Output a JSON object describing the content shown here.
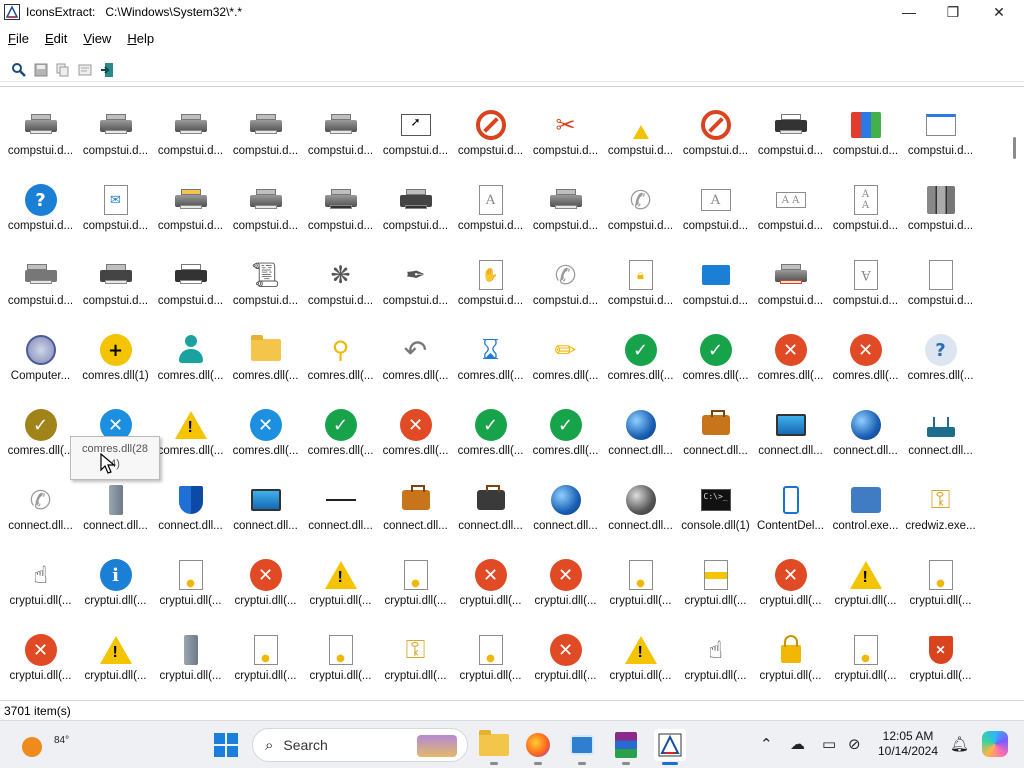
{
  "window": {
    "title": "IconsExtract:   C:\\Windows\\System32\\*.*",
    "minimize": "—",
    "maximize": "❐",
    "close": "✕"
  },
  "menu": [
    {
      "label": "File",
      "accel": "F",
      "rest": "ile"
    },
    {
      "label": "Edit",
      "accel": "E",
      "rest": "dit"
    },
    {
      "label": "View",
      "accel": "V",
      "rest": "iew"
    },
    {
      "label": "Help",
      "accel": "H",
      "rest": "elp"
    }
  ],
  "toolbar": [
    {
      "name": "find-icon",
      "glyph": "🔍"
    },
    {
      "name": "save-icon",
      "glyph": "💾"
    },
    {
      "name": "copy-icon",
      "glyph": "⧉"
    },
    {
      "name": "properties-icon",
      "glyph": "▤"
    },
    {
      "name": "exit-icon",
      "glyph": "⇥"
    }
  ],
  "icons": [
    [
      "printer",
      "compstui.d..."
    ],
    [
      "printer",
      "compstui.d..."
    ],
    [
      "printer",
      "compstui.d..."
    ],
    [
      "printer",
      "compstui.d..."
    ],
    [
      "printer-doc",
      "compstui.d..."
    ],
    [
      "cursor-box",
      "compstui.d..."
    ],
    [
      "no-entry",
      "compstui.d..."
    ],
    [
      "tools",
      "compstui.d..."
    ],
    [
      "small-warning",
      "compstui.d..."
    ],
    [
      "no-entry-warning",
      "compstui.d..."
    ],
    [
      "printer-dark",
      "compstui.d..."
    ],
    [
      "color-book",
      "compstui.d..."
    ],
    [
      "window-box",
      "compstui.d..."
    ],
    [
      "question",
      "compstui.d..."
    ],
    [
      "doc-mail",
      "compstui.d..."
    ],
    [
      "printer-folder",
      "compstui.d..."
    ],
    [
      "printer-doc",
      "compstui.d..."
    ],
    [
      "printer-disk",
      "compstui.d..."
    ],
    [
      "printer-disk-dark",
      "compstui.d..."
    ],
    [
      "doc-a",
      "compstui.d..."
    ],
    [
      "printer",
      "compstui.d..."
    ],
    [
      "phone",
      "compstui.d..."
    ],
    [
      "doc-a-wide",
      "compstui.d..."
    ],
    [
      "doc-aa",
      "compstui.d..."
    ],
    [
      "doc-a-stack",
      "compstui.d..."
    ],
    [
      "books",
      "compstui.d..."
    ],
    [
      "printer-side",
      "compstui.d..."
    ],
    [
      "printer-big",
      "compstui.d..."
    ],
    [
      "printer-paper",
      "compstui.d..."
    ],
    [
      "scroll",
      "compstui.d..."
    ],
    [
      "ornament",
      "compstui.d..."
    ],
    [
      "pen",
      "compstui.d..."
    ],
    [
      "doc-hand",
      "compstui.d..."
    ],
    [
      "phone",
      "compstui.d..."
    ],
    [
      "doc-lock",
      "compstui.d..."
    ],
    [
      "mail-arrow",
      "compstui.d..."
    ],
    [
      "printer-arrow",
      "compstui.d..."
    ],
    [
      "doc-a-flip",
      "compstui.d..."
    ],
    [
      "doc-blank",
      "compstui.d..."
    ],
    [
      "computer",
      "Computer..."
    ],
    [
      "plus-yellow",
      "comres.dll(1)"
    ],
    [
      "user",
      "comres.dll(..."
    ],
    [
      "folder-net",
      "comres.dll(..."
    ],
    [
      "network",
      "comres.dll(..."
    ],
    [
      "undo",
      "comres.dll(..."
    ],
    [
      "hourglass",
      "comres.dll(..."
    ],
    [
      "pencil",
      "comres.dll(..."
    ],
    [
      "check-hour",
      "comres.dll(..."
    ],
    [
      "check",
      "comres.dll(..."
    ],
    [
      "x-hour",
      "comres.dll(..."
    ],
    [
      "x",
      "comres.dll(..."
    ],
    [
      "question-grey",
      "comres.dll(..."
    ],
    [
      "check-gold",
      "comres.dll(..."
    ],
    [
      "x-blue",
      "comres.dll(28"
    ],
    [
      "warning",
      "comres.dll(..."
    ],
    [
      "x-blue-circle",
      "comres.dll(..."
    ],
    [
      "check-warn",
      "comres.dll(..."
    ],
    [
      "x-warn",
      "comres.dll(..."
    ],
    [
      "check-hour",
      "comres.dll(..."
    ],
    [
      "check-warn",
      "comres.dll(..."
    ],
    [
      "globe-arrows",
      "connect.dll..."
    ],
    [
      "briefcase",
      "connect.dll..."
    ],
    [
      "monitor",
      "connect.dll..."
    ],
    [
      "globe",
      "connect.dll..."
    ],
    [
      "router",
      "connect.dll..."
    ],
    [
      "phone",
      "connect.dll..."
    ],
    [
      "tower",
      "connect.dll..."
    ],
    [
      "shield",
      "connect.dll..."
    ],
    [
      "monitor",
      "connect.dll..."
    ],
    [
      "line",
      "connect.dll..."
    ],
    [
      "briefcase",
      "connect.dll..."
    ],
    [
      "briefcase-dark",
      "connect.dll..."
    ],
    [
      "globe",
      "connect.dll..."
    ],
    [
      "globe-grey",
      "connect.dll..."
    ],
    [
      "console",
      "console.dll(1)"
    ],
    [
      "mobile",
      "ContentDel..."
    ],
    [
      "control-panel",
      "control.exe..."
    ],
    [
      "key",
      "credwiz.exe..."
    ],
    [
      "hand",
      "cryptui.dll(..."
    ],
    [
      "info",
      "cryptui.dll(..."
    ],
    [
      "doc-cert",
      "cryptui.dll(..."
    ],
    [
      "x",
      "cryptui.dll(..."
    ],
    [
      "warning",
      "cryptui.dll(..."
    ],
    [
      "doc-cert",
      "cryptui.dll(..."
    ],
    [
      "x",
      "cryptui.dll(..."
    ],
    [
      "x",
      "cryptui.dll(..."
    ],
    [
      "doc-cert",
      "cryptui.dll(..."
    ],
    [
      "doc-yellow",
      "cryptui.dll(..."
    ],
    [
      "x",
      "cryptui.dll(..."
    ],
    [
      "warning",
      "cryptui.dll(..."
    ],
    [
      "doc-cert",
      "cryptui.dll(..."
    ],
    [
      "x",
      "cryptui.dll(..."
    ],
    [
      "warning",
      "cryptui.dll(..."
    ],
    [
      "tower",
      "cryptui.dll(..."
    ],
    [
      "doc-cert",
      "cryptui.dll(..."
    ],
    [
      "doc-cert",
      "cryptui.dll(..."
    ],
    [
      "key",
      "cryptui.dll(..."
    ],
    [
      "doc-cert",
      "cryptui.dll(..."
    ],
    [
      "x",
      "cryptui.dll(..."
    ],
    [
      "warning",
      "cryptui.dll(..."
    ],
    [
      "hand",
      "cryptui.dll(..."
    ],
    [
      "lock",
      "cryptui.dll(..."
    ],
    [
      "doc-cert",
      "cryptui.dll(..."
    ],
    [
      "shield-x",
      "cryptui.dll(..."
    ]
  ],
  "tooltip": {
    "line1": "comres.dll(28",
    "line2": "4)"
  },
  "status": {
    "items": "3701 item(s)"
  },
  "taskbar": {
    "temperature": "84°",
    "search_placeholder": "Search",
    "time": "12:05 AM",
    "date": "10/14/2024"
  }
}
